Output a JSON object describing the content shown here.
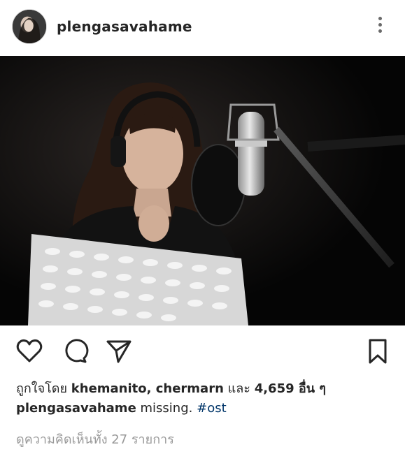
{
  "post": {
    "username": "plengasavahame",
    "more_icon": "more-vertical-icon",
    "actions": {
      "like_icon": "heart-icon",
      "comment_icon": "comment-icon",
      "share_icon": "send-icon",
      "save_icon": "bookmark-icon"
    },
    "likes": {
      "prefix": "ถูกใจโดย",
      "users": "khemanito, chermarn",
      "joiner": "และ",
      "others": "4,659 อื่น ๆ"
    },
    "caption": {
      "username": "plengasavahame",
      "text": "missing.",
      "hashtag": "#ost"
    },
    "view_comments": "ดูความคิดเห็นทั้ง 27 รายการ"
  },
  "colors": {
    "text": "#262626",
    "muted": "#999999",
    "hashtag": "#003569",
    "divider": "#dbdbdb"
  }
}
